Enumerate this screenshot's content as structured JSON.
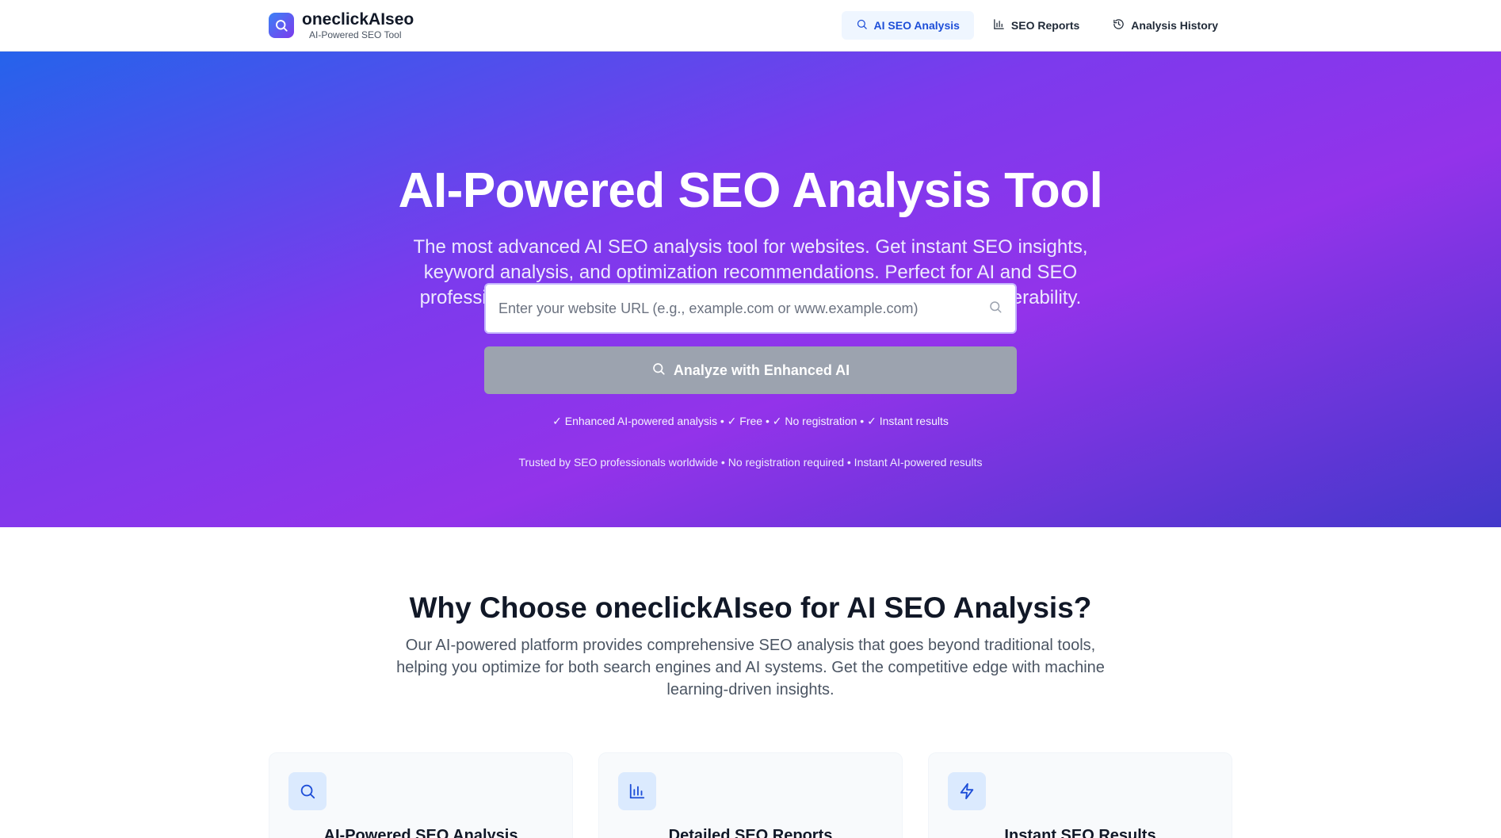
{
  "header": {
    "brand_name": "oneclickAIseo",
    "brand_tagline": "AI-Powered SEO Tool",
    "nav": [
      {
        "label": "AI SEO Analysis",
        "icon": "search-icon",
        "active": true
      },
      {
        "label": "SEO Reports",
        "icon": "bar-chart-icon",
        "active": false
      },
      {
        "label": "Analysis History",
        "icon": "history-icon",
        "active": false
      }
    ]
  },
  "hero": {
    "title": "AI-Powered SEO Analysis Tool",
    "subtitle": "The most advanced AI SEO analysis tool for websites. Get instant SEO insights, keyword analysis, and optimization recommendations. Perfect for AI and SEO professionals looking to improve search engine rankings and AI discoverability.",
    "search_placeholder": "Enter your website URL (e.g., example.com or www.example.com)",
    "search_value": "",
    "analyze_button": "Analyze with Enhanced AI",
    "checks": "✓ Enhanced AI-powered analysis • ✓ Free • ✓ No registration • ✓ Instant results",
    "trust": "Trusted by SEO professionals worldwide • No registration required • Instant AI-powered results"
  },
  "why": {
    "title": "Why Choose oneclickAIseo for AI SEO Analysis?",
    "subtitle": "Our AI-powered platform provides comprehensive SEO analysis that goes beyond traditional tools, helping you optimize for both search engines and AI systems. Get the competitive edge with machine learning-driven insights.",
    "cards": [
      {
        "title": "AI-Powered SEO Analysis",
        "icon": "search-icon"
      },
      {
        "title": "Detailed SEO Reports",
        "icon": "bar-chart-icon"
      },
      {
        "title": "Instant SEO Results",
        "icon": "lightning-icon"
      }
    ]
  },
  "colors": {
    "accent": "#1d4ed8",
    "hero_start": "#2563eb",
    "hero_mid": "#9333ea",
    "button_disabled": "#9ca3af"
  }
}
